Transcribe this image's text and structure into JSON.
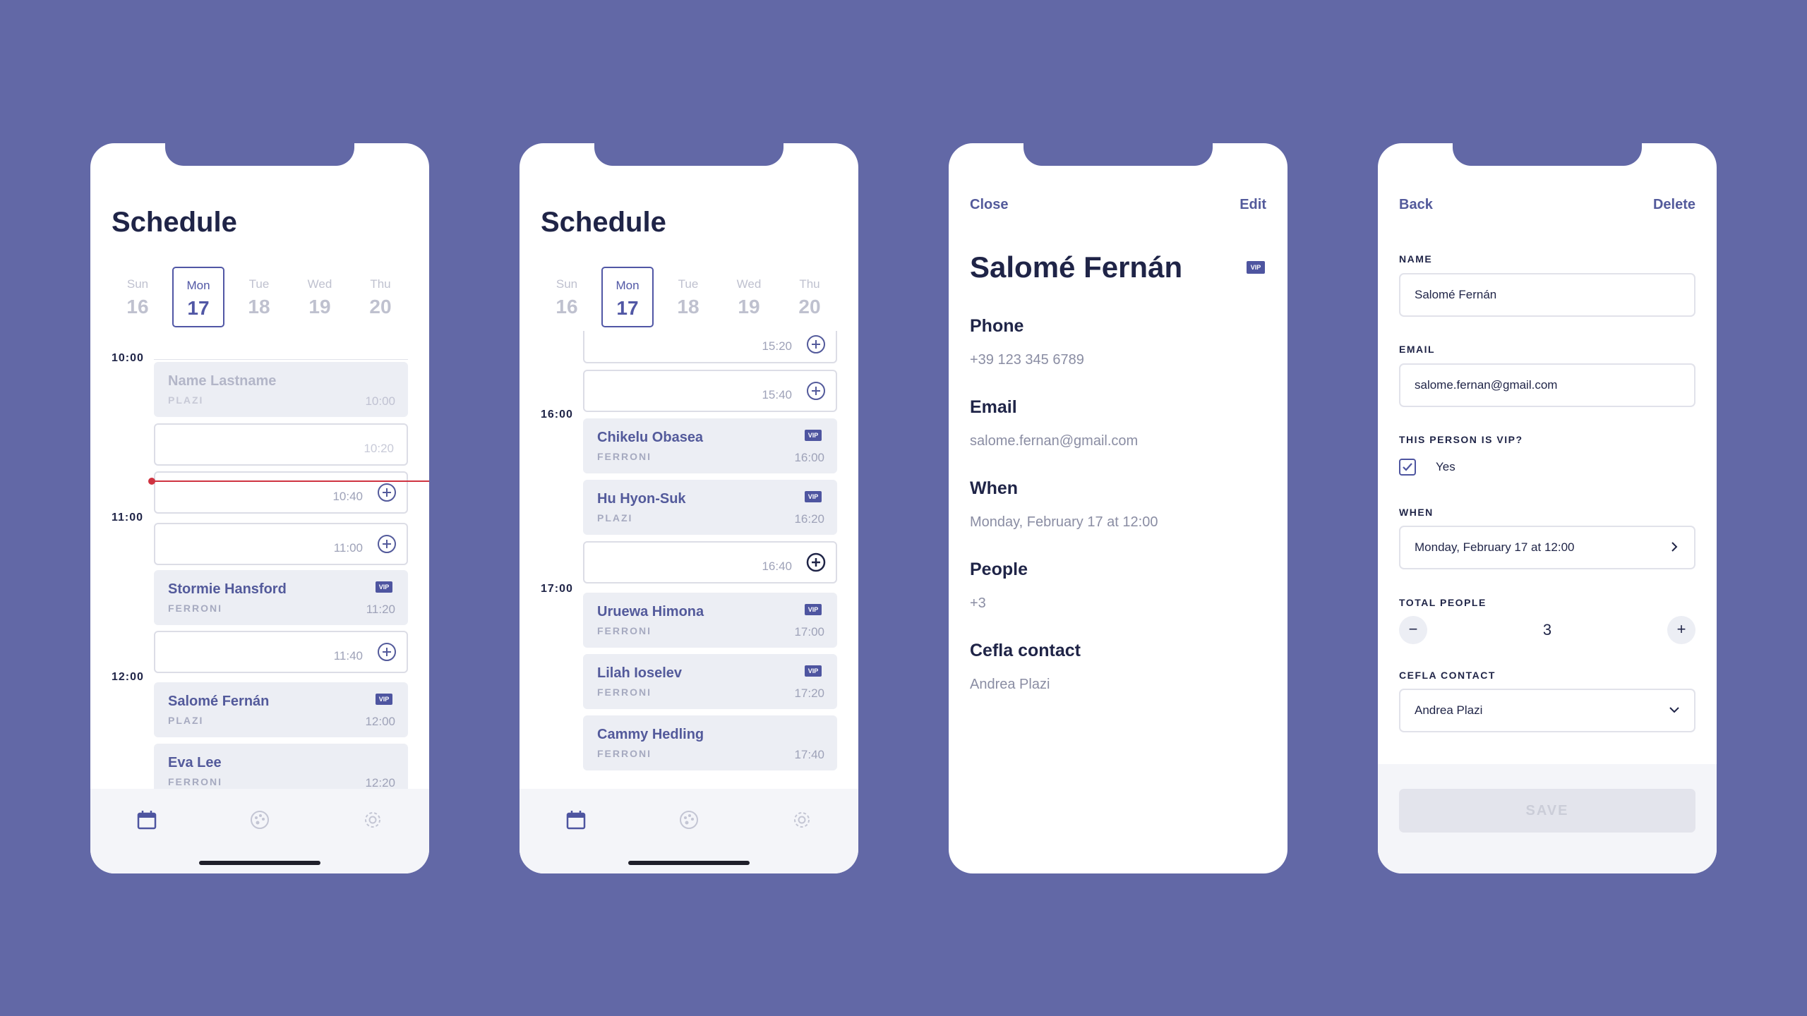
{
  "schedule1": {
    "title": "Schedule",
    "days": [
      {
        "name": "Sun",
        "date": "16"
      },
      {
        "name": "Mon",
        "date": "17"
      },
      {
        "name": "Tue",
        "date": "18"
      },
      {
        "name": "Wed",
        "date": "19"
      },
      {
        "name": "Thu",
        "date": "20"
      }
    ],
    "hours": [
      "10:00",
      "11:00",
      "12:00"
    ],
    "slots": [
      {
        "name": "Name Lastname",
        "location": "PLAZI",
        "time": "10:00"
      },
      {
        "time": "10:20"
      },
      {
        "time": "10:40"
      },
      {
        "time": "11:00"
      },
      {
        "name": "Stormie Hansford",
        "location": "FERRONI",
        "time": "11:20",
        "vip": "VIP"
      },
      {
        "time": "11:40"
      },
      {
        "name": "Salomé Fernán",
        "location": "PLAZI",
        "time": "12:00",
        "vip": "VIP"
      },
      {
        "name": "Eva Lee",
        "location": "FERRONI",
        "time": "12:20"
      }
    ]
  },
  "schedule2": {
    "title": "Schedule",
    "days": [
      {
        "name": "Sun",
        "date": "16"
      },
      {
        "name": "Mon",
        "date": "17"
      },
      {
        "name": "Tue",
        "date": "18"
      },
      {
        "name": "Wed",
        "date": "19"
      },
      {
        "name": "Thu",
        "date": "20"
      }
    ],
    "hours": [
      "16:00",
      "17:00"
    ],
    "slots": [
      {
        "time": "15:20"
      },
      {
        "time": "15:40"
      },
      {
        "name": "Chikelu Obasea",
        "location": "FERRONI",
        "time": "16:00",
        "vip": "VIP"
      },
      {
        "name": "Hu Hyon-Suk",
        "location": "PLAZI",
        "time": "16:20",
        "vip": "VIP"
      },
      {
        "time": "16:40"
      },
      {
        "name": "Uruewa Himona",
        "location": "FERRONI",
        "time": "17:00",
        "vip": "VIP"
      },
      {
        "name": "Lilah Ioselev",
        "location": "FERRONI",
        "time": "17:20",
        "vip": "VIP"
      },
      {
        "name": "Cammy Hedling",
        "location": "FERRONI",
        "time": "17:40"
      }
    ]
  },
  "detail": {
    "close": "Close",
    "edit": "Edit",
    "name": "Salomé Fernán",
    "vip": "VIP",
    "phone_label": "Phone",
    "phone": "+39 123 345 6789",
    "email_label": "Email",
    "email": "salome.fernan@gmail.com",
    "when_label": "When",
    "when": "Monday, February 17 at 12:00",
    "people_label": "People",
    "people": "+3",
    "contact_label": "Cefla contact",
    "contact": "Andrea Plazi"
  },
  "edit": {
    "back": "Back",
    "delete": "Delete",
    "name_label": "NAME",
    "name": "Salomé Fernán",
    "email_label": "EMAIL",
    "email": "salome.fernan@gmail.com",
    "vip_label": "THIS PERSON IS VIP?",
    "vip_yes": "Yes",
    "when_label": "WHEN",
    "when": "Monday, February 17 at 12:00",
    "people_label": "TOTAL PEOPLE",
    "minus": "−",
    "plus": "+",
    "people": "3",
    "contact_label": "CEFLA CONTACT",
    "contact": "Andrea Plazi",
    "save": "SAVE"
  },
  "colors": {
    "background": "#6268a6",
    "accent": "#5157a5",
    "vip_badge": "#4e55a0",
    "now_line": "#cf3340"
  },
  "icons": [
    "calendar-icon",
    "palette-icon",
    "settings-icon",
    "plus-circle-icon",
    "chevron-right-icon",
    "chevron-down-icon",
    "checkbox-checked-icon"
  ]
}
